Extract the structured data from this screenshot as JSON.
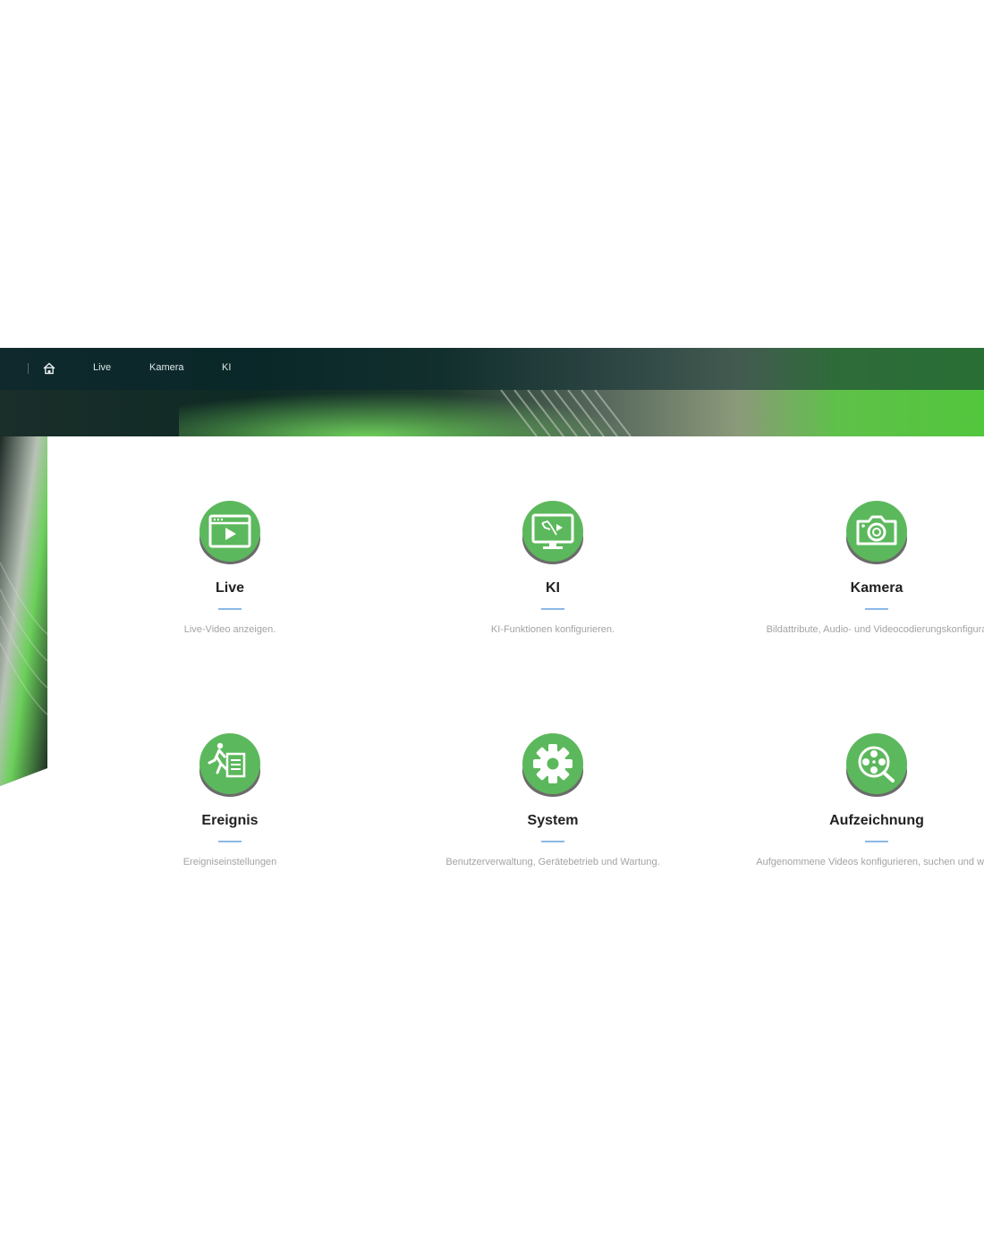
{
  "nav": {
    "items": [
      {
        "label": "Live"
      },
      {
        "label": "Kamera"
      },
      {
        "label": "KI"
      }
    ]
  },
  "tiles": [
    {
      "title": "Live",
      "description": "Live-Video anzeigen.",
      "icon": "live-video-icon"
    },
    {
      "title": "KI",
      "description": "KI-Funktionen konfigurieren.",
      "icon": "ai-monitor-icon"
    },
    {
      "title": "Kamera",
      "description": "Bildattribute, Audio- und Videocodierungskonfigura",
      "icon": "camera-icon"
    },
    {
      "title": "Ereignis",
      "description": "Ereigniseinstellungen",
      "icon": "event-icon"
    },
    {
      "title": "System",
      "description": "Benutzerverwaltung, Gerätebetrieb und Wartung.",
      "icon": "gear-icon"
    },
    {
      "title": "Aufzeichnung",
      "description": "Aufgenommene Videos konfigurieren, suchen und wied",
      "icon": "film-reel-search-icon"
    }
  ],
  "colors": {
    "accent_green": "#5cb85c",
    "icon_shadow": "#6b6b6b",
    "underline_blue": "#8cb8e8",
    "topbar": "#0a2a32"
  }
}
